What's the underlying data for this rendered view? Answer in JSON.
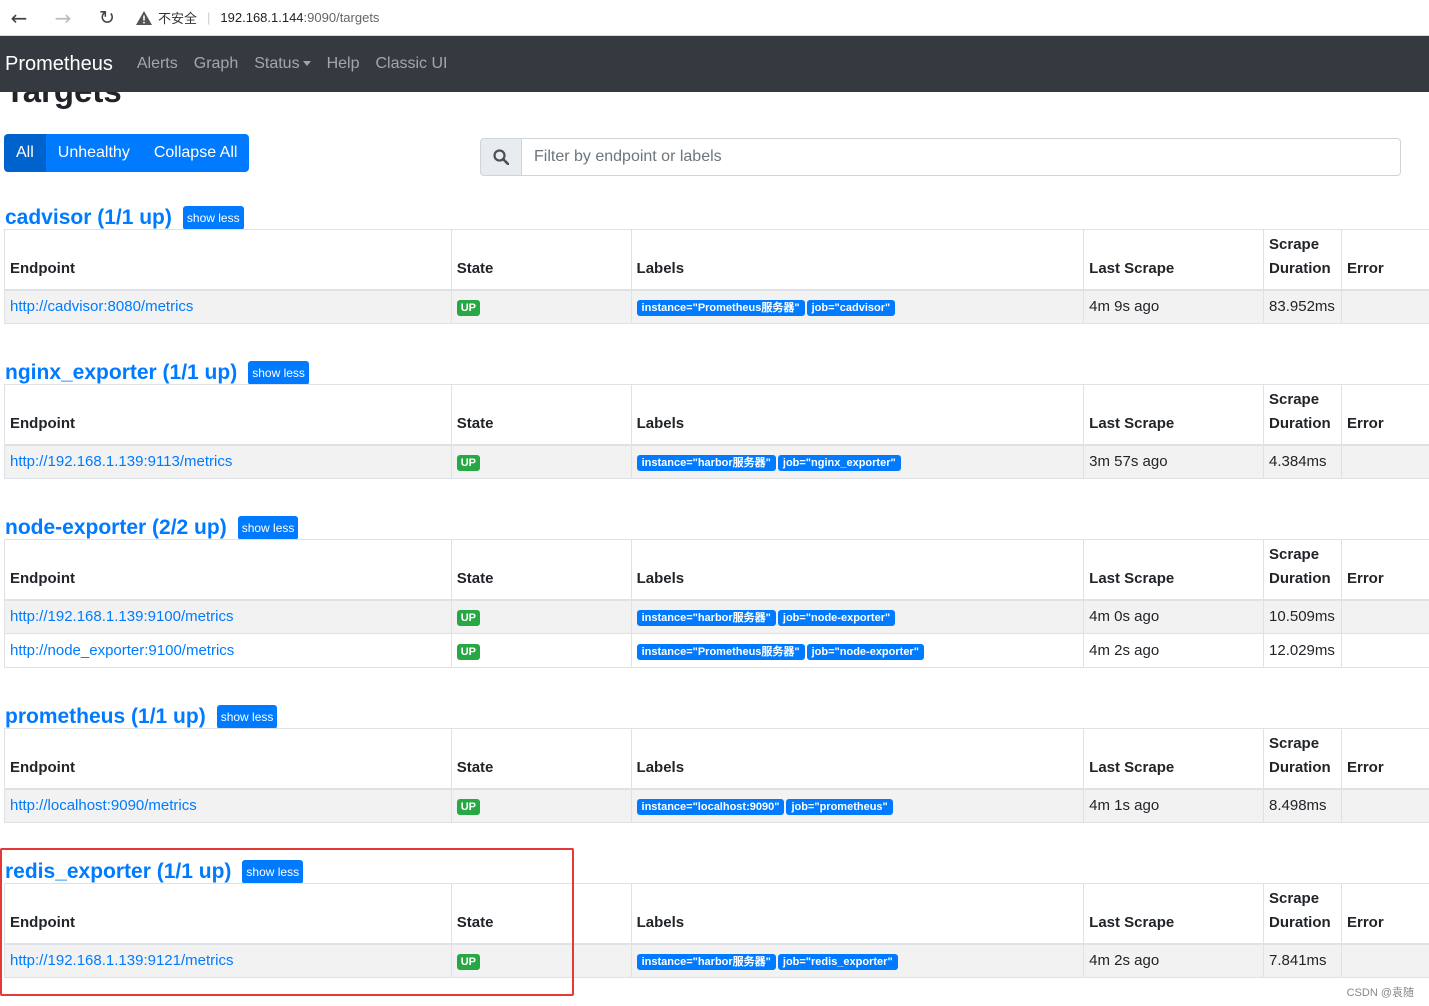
{
  "browser": {
    "insecure_label": "不安全",
    "url_host": "192.168.1.144",
    "url_rest": ":9090/targets"
  },
  "navbar": {
    "brand": "Prometheus",
    "links": [
      "Alerts",
      "Graph",
      "Status",
      "Help",
      "Classic UI"
    ]
  },
  "page": {
    "title": "Targets"
  },
  "filters": {
    "all": "All",
    "unhealthy": "Unhealthy",
    "collapse": "Collapse All",
    "search_placeholder": "Filter by endpoint or labels"
  },
  "table_headers": {
    "endpoint": "Endpoint",
    "state": "State",
    "labels": "Labels",
    "last_scrape": "Last Scrape",
    "scrape": "Scrape",
    "duration": "Duration",
    "error": "Error"
  },
  "show_less": "show less",
  "pools": [
    {
      "title": "cadvisor (1/1 up)",
      "targets": [
        {
          "endpoint": "http://cadvisor:8080/metrics",
          "state": "UP",
          "labels": [
            "instance=\"Prometheus服务器\"",
            "job=\"cadvisor\""
          ],
          "last_scrape": "4m 9s ago",
          "duration": "83.952ms",
          "error": ""
        }
      ]
    },
    {
      "title": "nginx_exporter (1/1 up)",
      "targets": [
        {
          "endpoint": "http://192.168.1.139:9113/metrics",
          "state": "UP",
          "labels": [
            "instance=\"harbor服务器\"",
            "job=\"nginx_exporter\""
          ],
          "last_scrape": "3m 57s ago",
          "duration": "4.384ms",
          "error": ""
        }
      ]
    },
    {
      "title": "node-exporter (2/2 up)",
      "targets": [
        {
          "endpoint": "http://192.168.1.139:9100/metrics",
          "state": "UP",
          "labels": [
            "instance=\"harbor服务器\"",
            "job=\"node-exporter\""
          ],
          "last_scrape": "4m 0s ago",
          "duration": "10.509ms",
          "error": ""
        },
        {
          "endpoint": "http://node_exporter:9100/metrics",
          "state": "UP",
          "labels": [
            "instance=\"Prometheus服务器\"",
            "job=\"node-exporter\""
          ],
          "last_scrape": "4m 2s ago",
          "duration": "12.029ms",
          "error": ""
        }
      ]
    },
    {
      "title": "prometheus (1/1 up)",
      "targets": [
        {
          "endpoint": "http://localhost:9090/metrics",
          "state": "UP",
          "labels": [
            "instance=\"localhost:9090\"",
            "job=\"prometheus\""
          ],
          "last_scrape": "4m 1s ago",
          "duration": "8.498ms",
          "error": ""
        }
      ]
    },
    {
      "title": "redis_exporter (1/1 up)",
      "targets": [
        {
          "endpoint": "http://192.168.1.139:9121/metrics",
          "state": "UP",
          "labels": [
            "instance=\"harbor服务器\"",
            "job=\"redis_exporter\""
          ],
          "last_scrape": "4m 2s ago",
          "duration": "7.841ms",
          "error": ""
        }
      ]
    }
  ],
  "watermark": "CSDN @袁随",
  "colors": {
    "brand_blue": "#007bff",
    "up_green": "#28a745",
    "navbar_bg": "#343a40",
    "highlight_red": "#e53935"
  }
}
